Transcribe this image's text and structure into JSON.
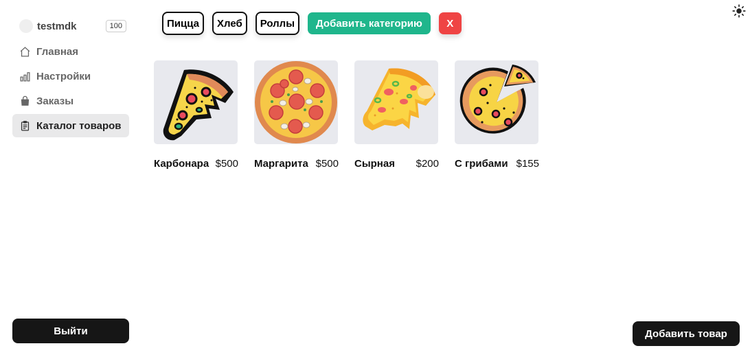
{
  "user": {
    "name": "testmdk",
    "balance": "100"
  },
  "nav": [
    {
      "label": "Главная",
      "icon": "home-icon",
      "active": false
    },
    {
      "label": "Настройки",
      "icon": "bar-chart-icon",
      "active": false
    },
    {
      "label": "Заказы",
      "icon": "shopping-bag-icon",
      "active": false
    },
    {
      "label": "Каталог товаров",
      "icon": "clipboard-icon",
      "active": true
    }
  ],
  "logout_label": "Выйти",
  "categories": [
    "Пицца",
    "Хлеб",
    "Роллы"
  ],
  "add_category_label": "Добавить категорию",
  "close_label": "X",
  "products": [
    {
      "name": "Карбонара",
      "price": "$500",
      "image": "pizza-slice-icon"
    },
    {
      "name": "Маргарита",
      "price": "$500",
      "image": "pepperoni-pizza-icon"
    },
    {
      "name": "Сырная",
      "price": "$200",
      "image": "cheese-pizza-slice-icon"
    },
    {
      "name": "С грибами",
      "price": "$155",
      "image": "pizza-missing-slice-icon"
    }
  ],
  "add_product_label": "Добавить товар",
  "colors": {
    "accent": "#1fb68c",
    "danger": "#ef4444",
    "dark": "#161616"
  }
}
